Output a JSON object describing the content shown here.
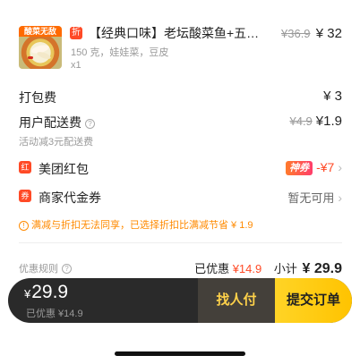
{
  "product": {
    "thumb_tag": "酸菜无敌",
    "discount_badge": "折",
    "name": "【经典口味】老坛酸菜鱼+五…",
    "original_price": "¥36.9",
    "price": "¥ 32",
    "spec": "150 克，娃娃菜，豆皮",
    "quantity": "x1"
  },
  "packing_fee": {
    "label": "打包费",
    "value": "¥ 3"
  },
  "delivery_fee": {
    "label": "用户配送费",
    "help_icon": "?",
    "original": "¥4.9",
    "value": "¥1.9",
    "note": "活动减3元配送费"
  },
  "red_packet": {
    "icon_text": "红",
    "label": "美团红包",
    "badge": "神券",
    "discount": "-¥7",
    "chevron": "›"
  },
  "voucher": {
    "icon_text": "券",
    "label": "商家代金券",
    "status": "暂无可用",
    "chevron": "›"
  },
  "notice": {
    "icon": "!",
    "text": "满减与折扣无法同享，已选择折扣比满减节省 ¥ 1.9"
  },
  "summary": {
    "rules_label": "优惠规则",
    "rules_icon": "?",
    "discounted_label": "已优惠",
    "discounted_value": "¥14.9",
    "subtotal_label": "小计",
    "subtotal_value": "¥ 29.9"
  },
  "checkout_bar": {
    "currency": "¥",
    "amount": "29.9",
    "saved_text": "已优惠 ¥14.9",
    "find_pay_label": "找人付",
    "submit_label": "提交订单"
  },
  "colors": {
    "accent_red": "#ff4a26",
    "accent_orange": "#ff8a00",
    "submit_yellow": "#ffc300",
    "bar_dark": "#2a2a2a"
  }
}
